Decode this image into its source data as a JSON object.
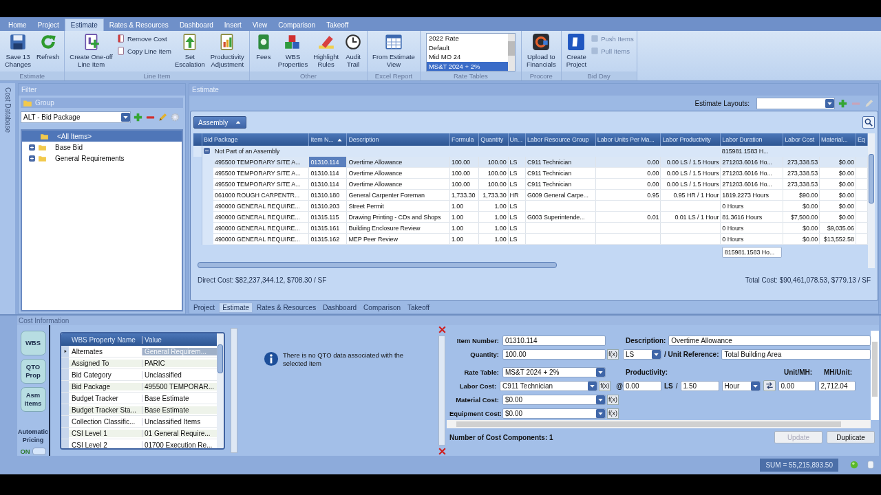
{
  "ribbon": {
    "tabs": [
      {
        "label": "Home",
        "selected": false
      },
      {
        "label": "Project",
        "selected": false
      },
      {
        "label": "Estimate",
        "selected": true
      },
      {
        "label": "Rates & Resources",
        "selected": false
      },
      {
        "label": "Dashboard",
        "selected": false
      },
      {
        "label": "Insert",
        "selected": false
      },
      {
        "label": "View",
        "selected": false
      },
      {
        "label": "Comparison",
        "selected": false
      },
      {
        "label": "Takeoff",
        "selected": false
      }
    ],
    "groups": [
      {
        "label": "Estimate",
        "items": [
          {
            "kind": "large",
            "label": "Save 13\nChanges"
          },
          {
            "kind": "large",
            "label": "Refresh"
          }
        ]
      },
      {
        "label": "Line Item",
        "items": [
          {
            "kind": "large",
            "label": "Create One-off\nLine Item"
          },
          {
            "kind": "stack",
            "items": [
              {
                "label": "Remove Cost",
                "disabled": false
              },
              {
                "label": "Copy Line Item",
                "disabled": false
              }
            ]
          },
          {
            "kind": "large",
            "label": "Set\nEscalation"
          },
          {
            "kind": "large",
            "label": "Productivity\nAdjustment"
          }
        ]
      },
      {
        "label": "Other",
        "items": [
          {
            "kind": "large",
            "label": "Fees"
          },
          {
            "kind": "large",
            "label": "WBS\nProperties"
          },
          {
            "kind": "large",
            "label": "Highlight\nRules"
          },
          {
            "kind": "large",
            "label": "Audit\nTrail"
          }
        ]
      },
      {
        "label": "Excel Report",
        "items": [
          {
            "kind": "large",
            "label": "From Estimate\nView"
          }
        ]
      },
      {
        "label": "Rate Tables",
        "items": [
          {
            "kind": "list",
            "options": [
              {
                "label": "2022 Rate",
                "selected": false
              },
              {
                "label": "Default",
                "selected": false
              },
              {
                "label": "Mid MO 24",
                "selected": false
              },
              {
                "label": "MS&T 2024 + 2%",
                "selected": true
              }
            ]
          }
        ]
      },
      {
        "label": "Procore",
        "items": [
          {
            "kind": "large",
            "label": "Upload to\nFinancials"
          }
        ]
      },
      {
        "label": "Bid Day",
        "items": [
          {
            "kind": "large",
            "label": "Create\nProject"
          },
          {
            "kind": "stack",
            "items": [
              {
                "label": "Push Items",
                "disabled": true
              },
              {
                "label": "Pull Items",
                "disabled": true
              }
            ]
          }
        ]
      }
    ]
  },
  "side_strip": {
    "label": "Cost Database"
  },
  "filter": {
    "title": "Filter",
    "group_title": "Group",
    "group_select": "ALT - Bid Package",
    "tree": [
      {
        "label": "<All Items>",
        "selected": true,
        "children": [
          {
            "label": "Base Bid",
            "selected": false,
            "expanded": false
          },
          {
            "label": "General Requirements",
            "selected": false,
            "expanded": false
          }
        ]
      }
    ]
  },
  "estimate": {
    "title": "Estimate",
    "layouts_label": "Estimate Layouts:",
    "group_by": "Assembly",
    "columns": [
      {
        "label": "Bid Package",
        "sorted": false
      },
      {
        "label": "Item N...",
        "sorted": true
      },
      {
        "label": "Description",
        "sorted": false
      },
      {
        "label": "Formula",
        "sorted": false
      },
      {
        "label": "Quantity",
        "sorted": false
      },
      {
        "label": "Un...",
        "sorted": false
      },
      {
        "label": "Labor Resource Group",
        "sorted": false
      },
      {
        "label": "Labor Units Per Ma...",
        "sorted": false
      },
      {
        "label": "Labor Productivity",
        "sorted": false
      },
      {
        "label": "Labor Duration",
        "sorted": false
      },
      {
        "label": "Labor Cost",
        "sorted": false
      },
      {
        "label": "Material...",
        "sorted": false
      },
      {
        "label": "Eq",
        "sorted": false
      }
    ],
    "group": {
      "label": "Not Part of an Assembly",
      "expanded": true,
      "summary": "815981.1583 H..."
    },
    "rows": [
      {
        "selected": true,
        "cells": [
          "495500 TEMPORARY SITE A...",
          "01310.114",
          "Overtime Allowance",
          "100.00",
          "100.00",
          "LS",
          "C911 Technician",
          "0.00",
          "0.00 LS / 1.5 Hours",
          "271203.6016 Ho...",
          "273,338.53",
          "$0.00",
          null
        ]
      },
      {
        "selected": false,
        "cells": [
          "495500 TEMPORARY SITE A...",
          "01310.114",
          "Overtime Allowance",
          "100.00",
          "100.00",
          "LS",
          "C911 Technician",
          "0.00",
          "0.00 LS / 1.5 Hours",
          "271203.6016 Ho...",
          "273,338.53",
          "$0.00",
          null
        ]
      },
      {
        "selected": false,
        "cells": [
          "495500 TEMPORARY SITE A...",
          "01310.114",
          "Overtime Allowance",
          "100.00",
          "100.00",
          "LS",
          "C911 Technician",
          "0.00",
          "0.00 LS / 1.5 Hours",
          "271203.6016 Ho...",
          "273,338.53",
          "$0.00",
          null
        ]
      },
      {
        "selected": false,
        "cells": [
          "061000 ROUGH CARPENTR...",
          "01310.180",
          "General Carpenter Foreman",
          "1,733.30",
          "1,733.30",
          "HR",
          "G009 General Carpe...",
          "0.95",
          "0.95 HR / 1 Hour",
          "1819.2273 Hours",
          "$90.00",
          "$0.00",
          null
        ]
      },
      {
        "selected": false,
        "cells": [
          "490000 GENERAL REQUIRE...",
          "01310.203",
          "Street Permit",
          "1.00",
          "1.00",
          "LS",
          null,
          null,
          null,
          "0 Hours",
          "$0.00",
          "$0.00",
          null
        ]
      },
      {
        "selected": false,
        "cells": [
          "490000 GENERAL REQUIRE...",
          "01315.115",
          "Drawing Printing - CDs and Shops",
          "1.00",
          "1.00",
          "LS",
          "G003 Superintende...",
          "0.01",
          "0.01 LS / 1 Hour",
          "81.3616 Hours",
          "$7,500.00",
          "$0.00",
          null
        ]
      },
      {
        "selected": false,
        "cells": [
          "490000 GENERAL REQUIRE...",
          "01315.161",
          "Building Enclosure Review",
          "1.00",
          "1.00",
          "LS",
          null,
          null,
          null,
          "0 Hours",
          "$0.00",
          "$9,035.06",
          null
        ]
      },
      {
        "selected": false,
        "cells": [
          "490000 GENERAL REQUIRE...",
          "01315.162",
          "MEP Peer Review",
          "1.00",
          "1.00",
          "LS",
          null,
          null,
          null,
          "0 Hours",
          "$0.00",
          "$13,552.58",
          null
        ]
      }
    ],
    "footer_summary": "815981.1583 Ho...",
    "direct_cost": "Direct Cost: $82,237,344.12, $708.30 / SF",
    "total_cost": "Total Cost: $90,461,078.53, $779.13 / SF",
    "tabs": [
      {
        "label": "Project",
        "selected": false
      },
      {
        "label": "Estimate",
        "selected": true
      },
      {
        "label": "Rates & Resources",
        "selected": false
      },
      {
        "label": "Dashboard",
        "selected": false
      },
      {
        "label": "Comparison",
        "selected": false
      },
      {
        "label": "Takeoff",
        "selected": false
      }
    ]
  },
  "cost": {
    "title": "Cost Information",
    "side_buttons": [
      {
        "label": "WBS"
      },
      {
        "label": "QTO\nProp"
      },
      {
        "label": "Asm\nItems"
      }
    ],
    "auto_pricing": {
      "label": "Automatic\nPricing",
      "state_label": "ON",
      "on": true
    },
    "wbs_grid": {
      "columns": [
        "WBS Property Name",
        "Value"
      ],
      "rows": [
        {
          "name": "Alternates",
          "value": "General Requirem...",
          "selected": true
        },
        {
          "name": "Assigned To",
          "value": "PARIC",
          "selected": false
        },
        {
          "name": "Bid Category",
          "value": "Unclassified",
          "selected": false
        },
        {
          "name": "Bid Package",
          "value": "495500 TEMPORAR...",
          "selected": false
        },
        {
          "name": "Budget Tracker",
          "value": "Base Estimate",
          "selected": false
        },
        {
          "name": "Budget Tracker Sta...",
          "value": "Base Estimate",
          "selected": false
        },
        {
          "name": "Collection Classific...",
          "value": "Unclassified Items",
          "selected": false
        },
        {
          "name": "CSI Level 1",
          "value": "01 General Require...",
          "selected": false
        },
        {
          "name": "CSI Level 2",
          "value": "01700 Execution Re...",
          "selected": false
        }
      ]
    },
    "qto_message": "There is no QTO data associated with the selected item",
    "form": {
      "item_number_label": "Item Number:",
      "item_number": "01310.114",
      "description_label": "Description:",
      "description": "Overtime Allowance",
      "quantity_label": "Quantity:",
      "quantity": "100.00",
      "quantity_fx": "f(x)",
      "unit": "LS",
      "unit_reference_label": "/ Unit Reference:",
      "unit_reference": "Total Building Area",
      "rate_table_label": "Rate Table:",
      "rate_table": "MS&T 2024 + 2%",
      "productivity_label": "Productivity:",
      "unit_mh_label": "Unit/MH:",
      "mh_unit_label": "MH/Unit:",
      "costs": [
        {
          "label": "Labor Cost:",
          "value": "C911 Technician",
          "fx": "f(x)"
        },
        {
          "label": "Material Cost:",
          "value": "$0.00",
          "fx": "f(x)"
        },
        {
          "label": "Equipment Cost:",
          "value": "$0.00",
          "fx": "f(x)"
        }
      ],
      "at": "@",
      "productivity_units": "0.00",
      "productivity_unit": "LS",
      "slash": "/",
      "productivity_time": "1.50",
      "time_unit": "Hour",
      "unit_mh": "0.00",
      "mh_unit": "2,712.04"
    },
    "component_count_label": "Number of Cost Components:",
    "component_count": "1",
    "buttons": [
      {
        "label": "Update",
        "disabled": true
      },
      {
        "label": "Duplicate",
        "disabled": false
      }
    ]
  },
  "status_bar": {
    "sum": "SUM = 55,215,893.50"
  }
}
